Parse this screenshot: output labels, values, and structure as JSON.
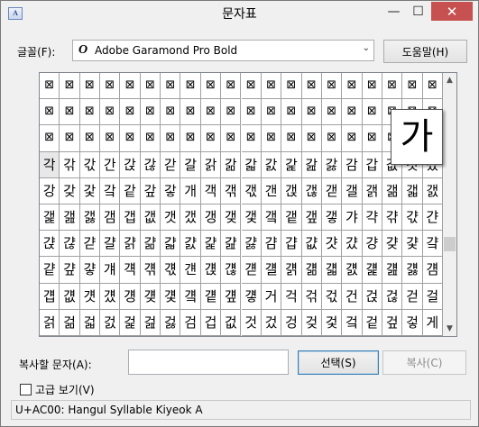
{
  "window": {
    "title": "문자표",
    "icon": "charmap-app-icon",
    "minimize_glyph": "—",
    "maximize_glyph": "☐",
    "close_glyph": "✕"
  },
  "font": {
    "label": "글꼴(F):",
    "selected": "Adobe Garamond Pro Bold",
    "type_icon": "opentype-o-icon",
    "type_glyph": "O"
  },
  "help_button": "도움말(H)",
  "grid": {
    "rows": [
      [
        "⊠",
        "⊠",
        "⊠",
        "⊠",
        "⊠",
        "⊠",
        "⊠",
        "⊠",
        "⊠",
        "⊠",
        "⊠",
        "⊠",
        "⊠",
        "⊠",
        "⊠",
        "⊠",
        "⊠",
        "⊠",
        "⊠",
        "⊠"
      ],
      [
        "⊠",
        "⊠",
        "⊠",
        "⊠",
        "⊠",
        "⊠",
        "⊠",
        "⊠",
        "⊠",
        "⊠",
        "⊠",
        "⊠",
        "⊠",
        "⊠",
        "⊠",
        "⊠",
        "⊠",
        "⊠",
        "⊠",
        "⊠"
      ],
      [
        "⊠",
        "⊠",
        "⊠",
        "⊠",
        "⊠",
        "⊠",
        "⊠",
        "⊠",
        "⊠",
        "⊠",
        "⊠",
        "⊠",
        "⊠",
        "⊠",
        "⊠",
        "⊠",
        "⊠",
        "⊠",
        "⊠",
        "⊠"
      ],
      [
        "각",
        "갂",
        "갃",
        "간",
        "갅",
        "갆",
        "갇",
        "갈",
        "갉",
        "갊",
        "갋",
        "갌",
        "갍",
        "갎",
        "갏",
        "감",
        "갑",
        "값",
        "갓",
        "갔"
      ],
      [
        "강",
        "갖",
        "갗",
        "갘",
        "같",
        "갚",
        "갛",
        "개",
        "객",
        "갞",
        "갟",
        "갠",
        "갡",
        "갢",
        "갣",
        "갤",
        "갥",
        "갦",
        "갧",
        "갨"
      ],
      [
        "갩",
        "갪",
        "갫",
        "갬",
        "갭",
        "갮",
        "갯",
        "갰",
        "갱",
        "갲",
        "갳",
        "갴",
        "갵",
        "갶",
        "갷",
        "갸",
        "갹",
        "갺",
        "갻",
        "갼"
      ],
      [
        "갽",
        "갾",
        "갿",
        "걀",
        "걁",
        "걂",
        "걃",
        "걄",
        "걅",
        "걆",
        "걇",
        "걈",
        "걉",
        "걊",
        "걋",
        "걌",
        "걍",
        "걎",
        "걏",
        "걐"
      ],
      [
        "걑",
        "걒",
        "걓",
        "걔",
        "걕",
        "걖",
        "걗",
        "걘",
        "걙",
        "걚",
        "걛",
        "걜",
        "걝",
        "걞",
        "걟",
        "걠",
        "걡",
        "걢",
        "걣",
        "걤"
      ],
      [
        "걥",
        "걦",
        "걧",
        "걨",
        "걩",
        "걪",
        "걫",
        "걬",
        "걭",
        "걮",
        "걯",
        "거",
        "걱",
        "걲",
        "걳",
        "건",
        "걵",
        "걶",
        "걷",
        "걸"
      ],
      [
        "걹",
        "걺",
        "걻",
        "걼",
        "걽",
        "걾",
        "걿",
        "검",
        "겁",
        "겂",
        "것",
        "겄",
        "겅",
        "겆",
        "겇",
        "겈",
        "겉",
        "겊",
        "겋",
        "게"
      ]
    ],
    "selected_row": 3,
    "selected_col": 0
  },
  "magnified_char": "가",
  "scrollbar": {
    "up_glyph": "▲",
    "down_glyph": "▼"
  },
  "copy": {
    "label": "복사할 문자(A):",
    "value": "",
    "select_button": "선택(S)",
    "copy_button": "복사(C)"
  },
  "advanced": {
    "label": "고급 보기(V)",
    "checked": false
  },
  "status_bar": "U+AC00: Hangul Syllable Kiyeok A"
}
